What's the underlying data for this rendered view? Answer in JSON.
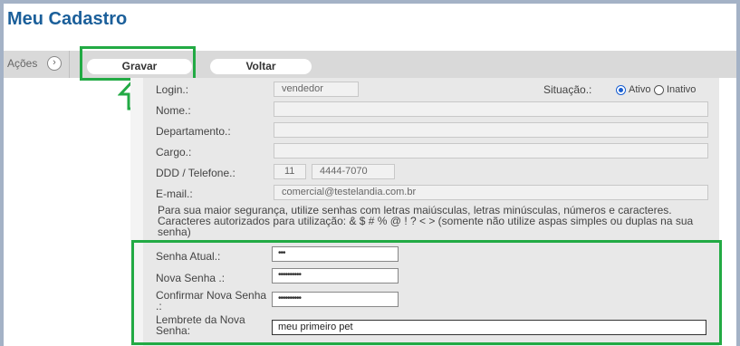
{
  "page": {
    "title": "Meu Cadastro"
  },
  "actions": {
    "label": "Ações",
    "expand_symbol": "›",
    "save_label": "Gravar",
    "back_label": "Voltar"
  },
  "form": {
    "login": {
      "label": "Login.:",
      "value": "vendedor"
    },
    "status": {
      "label": "Situação.:",
      "active_label": "Ativo",
      "inactive_label": "Inativo",
      "selected": "Ativo"
    },
    "name": {
      "label": "Nome.:",
      "value": ""
    },
    "department": {
      "label": "Departamento.:",
      "value": ""
    },
    "role": {
      "label": "Cargo.:",
      "value": ""
    },
    "phone": {
      "label": "DDD / Telefone.:",
      "ddd": "11",
      "number": "4444-7070"
    },
    "email": {
      "label": "E-mail.:",
      "value": "comercial@testelandia.com.br"
    },
    "help_text": "Para sua maior segurança, utilize senhas com letras maiúsculas, letras minúsculas, números e caracteres. Caracteres autorizados para utilização: & $ # % @ ! ? < > (somente não utilize aspas simples ou duplas na sua senha)",
    "current_password": {
      "label": "Senha Atual.:",
      "value": "•••"
    },
    "new_password": {
      "label": "Nova Senha .:",
      "value": "••••••••••"
    },
    "confirm_password": {
      "label": "Confirmar Nova Senha .:",
      "value": "••••••••••"
    },
    "password_hint": {
      "label": "Lembrete da Nova Senha:",
      "value": "meu primeiro pet"
    }
  },
  "colors": {
    "title": "#1b5f9a",
    "highlight": "#22aa44",
    "radio_selected": "#1a5fd0"
  },
  "icons": {
    "highlight_arrow": "up-arrow-icon"
  }
}
